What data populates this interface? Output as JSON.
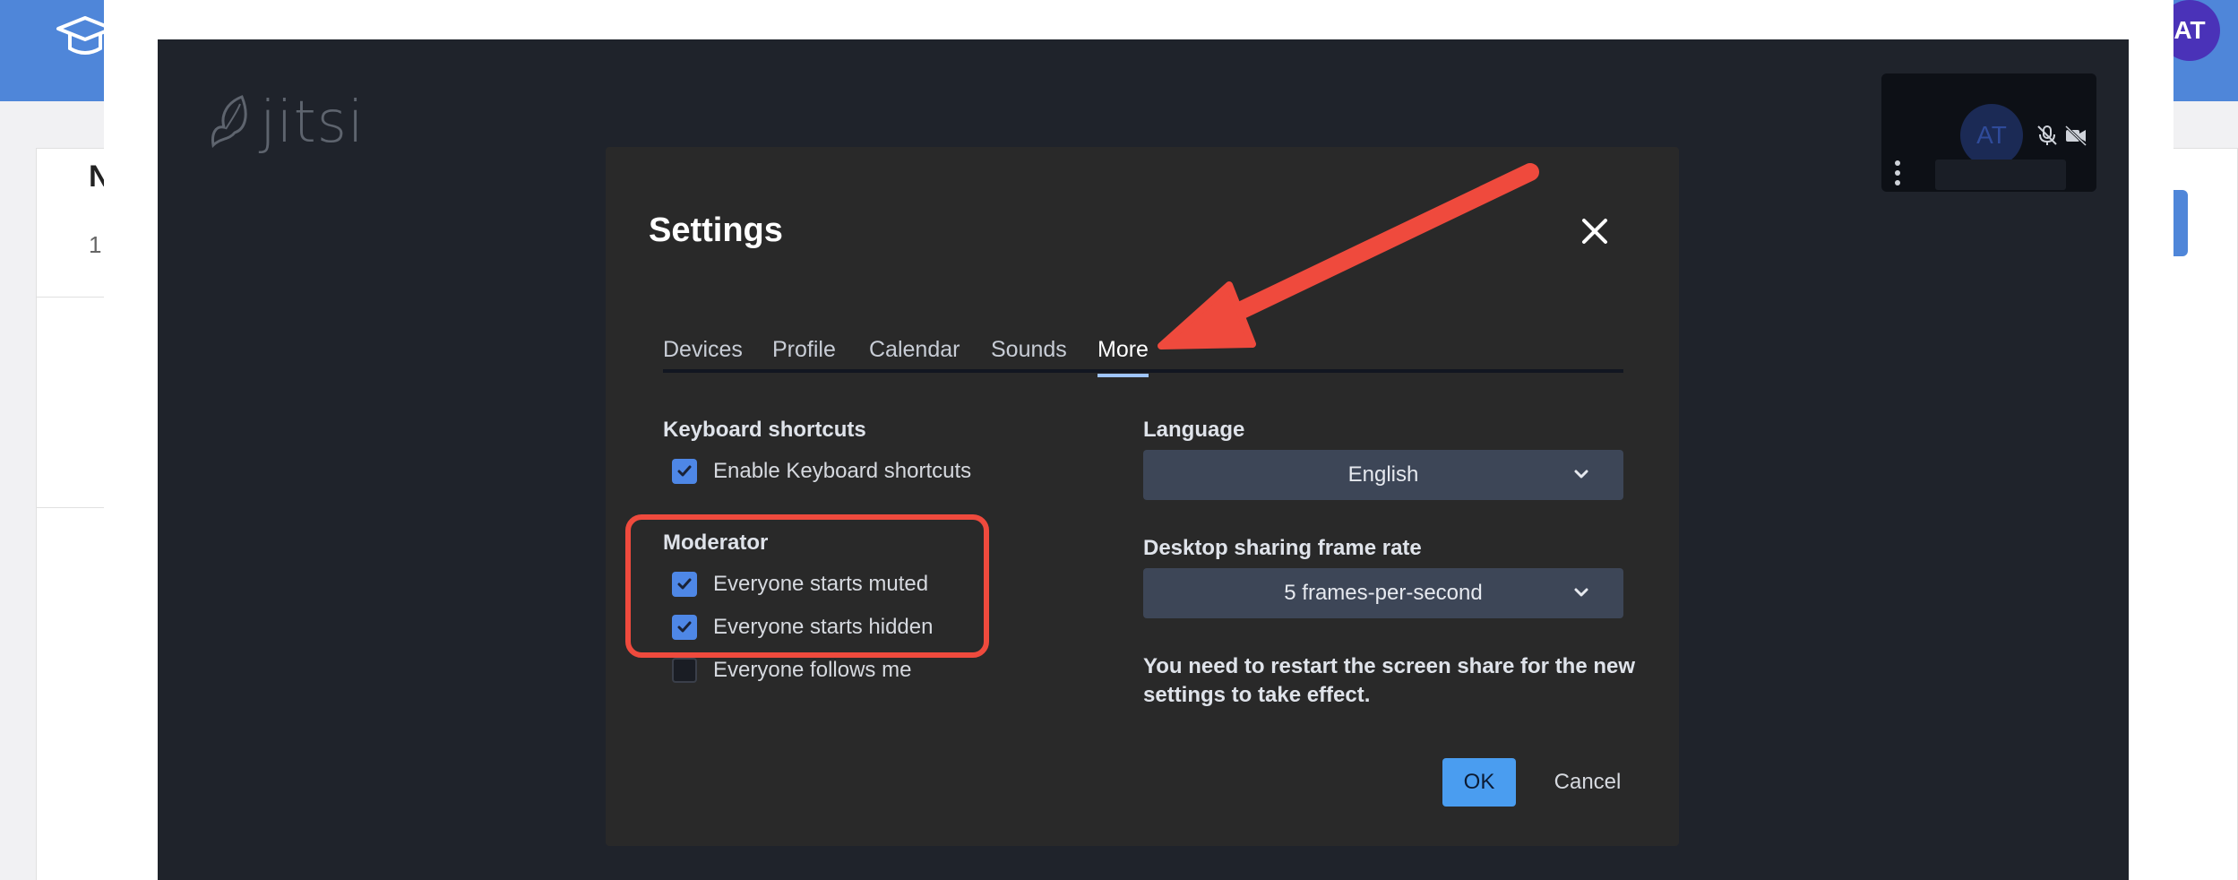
{
  "background": {
    "avatar_initials": "AT",
    "card_heading_fragment": "N",
    "card_sub_fragment": "1",
    "colors": {
      "topbar": "#4f86d9",
      "avatar": "#4a32b8"
    }
  },
  "meeting": {
    "logo_text": "jitsi",
    "thumbnail": {
      "initials": "AT"
    }
  },
  "dialog": {
    "title": "Settings",
    "tabs": [
      {
        "label": "Devices",
        "active": false
      },
      {
        "label": "Profile",
        "active": false
      },
      {
        "label": "Calendar",
        "active": false
      },
      {
        "label": "Sounds",
        "active": false
      },
      {
        "label": "More",
        "active": true
      }
    ],
    "keyboard": {
      "heading": "Keyboard shortcuts",
      "enable_label": "Enable Keyboard shortcuts",
      "enable_checked": true
    },
    "moderator": {
      "heading": "Moderator",
      "options": [
        {
          "label": "Everyone starts muted",
          "checked": true
        },
        {
          "label": "Everyone starts hidden",
          "checked": true
        },
        {
          "label": "Everyone follows me",
          "checked": false
        }
      ]
    },
    "language": {
      "heading": "Language",
      "selected": "English"
    },
    "framerate": {
      "heading": "Desktop sharing frame rate",
      "selected": "5 frames-per-second"
    },
    "notice": "You need to restart the screen share for the new settings to take effect.",
    "ok_label": "OK",
    "cancel_label": "Cancel"
  },
  "annotation_color": "#ef4a3d"
}
